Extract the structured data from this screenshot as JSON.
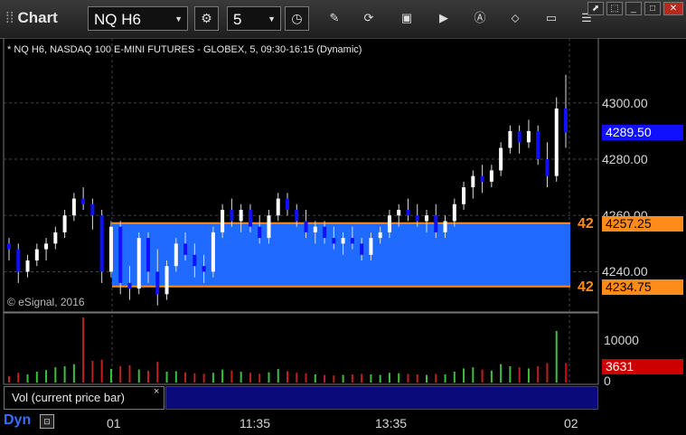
{
  "toolbar": {
    "app_title": "Chart",
    "symbol": "NQ H6",
    "interval": "5"
  },
  "chart": {
    "header_text": "* NQ H6, NASDAQ 100 E-MINI FUTURES - GLOBEX, 5, 09:30-16:15 (Dynamic)",
    "copyright": "© eSignal, 2016",
    "price_ticks": [
      "4300.00",
      "4280.00",
      "4260.00",
      "4240.00"
    ],
    "price_tick_values": [
      4300,
      4280,
      4260,
      4240
    ],
    "last_price": "4289.50",
    "zone_top": {
      "value": 4257.25,
      "label": "4257.25",
      "flag": "42"
    },
    "zone_bottom": {
      "value": 4234.75,
      "label": "4234.75",
      "flag": "42"
    },
    "colors": {
      "up": "#ffffff",
      "down": "#1010ff",
      "zone": "#1f6bff",
      "zone_line": "#ff8c1a",
      "last_price": "#1010ff",
      "volume_last": "#cc0000"
    }
  },
  "volume": {
    "panel_label": "Vol (current price bar)",
    "close_symbol": "×",
    "axis_ticks": [
      "10000",
      "0"
    ],
    "last_volume": "3631"
  },
  "time_axis": [
    "01",
    "11:35",
    "13:35",
    "02"
  ],
  "status": {
    "mode": "Dyn"
  },
  "chart_data": {
    "type": "candlestick",
    "y_range": [
      4226,
      4316
    ],
    "vol_range": [
      0,
      12500
    ],
    "candles": [
      [
        4250,
        4252,
        4244,
        4248,
        1200
      ],
      [
        4248,
        4250,
        4236,
        4240,
        1800
      ],
      [
        4240,
        4246,
        4238,
        4244,
        1500
      ],
      [
        4244,
        4250,
        4242,
        4248,
        2000
      ],
      [
        4248,
        4252,
        4244,
        4250,
        2300
      ],
      [
        4250,
        4256,
        4248,
        4254,
        2800
      ],
      [
        4254,
        4262,
        4252,
        4260,
        3000
      ],
      [
        4260,
        4268,
        4258,
        4266,
        3400
      ],
      [
        4266,
        4270,
        4262,
        4264,
        12000
      ],
      [
        4264,
        4266,
        4255,
        4260,
        4000
      ],
      [
        4260,
        4262,
        4236,
        4240,
        4200
      ],
      [
        4240,
        4258,
        4238,
        4256,
        2500
      ],
      [
        4256,
        4258,
        4232,
        4236,
        3000
      ],
      [
        4236,
        4242,
        4230,
        4234,
        3200
      ],
      [
        4234,
        4254,
        4232,
        4252,
        2400
      ],
      [
        4252,
        4254,
        4236,
        4240,
        2200
      ],
      [
        4240,
        4248,
        4228,
        4232,
        3800
      ],
      [
        4232,
        4244,
        4230,
        4242,
        2000
      ],
      [
        4242,
        4252,
        4240,
        4250,
        2100
      ],
      [
        4250,
        4254,
        4244,
        4246,
        1900
      ],
      [
        4246,
        4250,
        4238,
        4242,
        1700
      ],
      [
        4242,
        4246,
        4236,
        4240,
        1600
      ],
      [
        4240,
        4256,
        4238,
        4254,
        1800
      ],
      [
        4254,
        4264,
        4252,
        4262,
        2400
      ],
      [
        4262,
        4266,
        4256,
        4258,
        2200
      ],
      [
        4258,
        4264,
        4254,
        4262,
        2000
      ],
      [
        4262,
        4264,
        4254,
        4256,
        1800
      ],
      [
        4256,
        4260,
        4250,
        4252,
        1600
      ],
      [
        4252,
        4262,
        4250,
        4260,
        1900
      ],
      [
        4260,
        4268,
        4258,
        4266,
        2500
      ],
      [
        4266,
        4268,
        4260,
        4262,
        2100
      ],
      [
        4262,
        4264,
        4256,
        4258,
        1800
      ],
      [
        4258,
        4262,
        4252,
        4254,
        1700
      ],
      [
        4254,
        4258,
        4250,
        4256,
        1500
      ],
      [
        4256,
        4258,
        4250,
        4252,
        1400
      ],
      [
        4252,
        4256,
        4248,
        4250,
        1300
      ],
      [
        4250,
        4254,
        4246,
        4252,
        1400
      ],
      [
        4252,
        4256,
        4248,
        4250,
        1500
      ],
      [
        4250,
        4252,
        4244,
        4246,
        1600
      ],
      [
        4246,
        4254,
        4244,
        4252,
        1500
      ],
      [
        4252,
        4256,
        4250,
        4254,
        1400
      ],
      [
        4254,
        4262,
        4252,
        4260,
        1800
      ],
      [
        4260,
        4264,
        4256,
        4262,
        1700
      ],
      [
        4262,
        4266,
        4258,
        4260,
        1600
      ],
      [
        4260,
        4264,
        4256,
        4258,
        1500
      ],
      [
        4258,
        4262,
        4254,
        4260,
        1400
      ],
      [
        4260,
        4264,
        4252,
        4254,
        1600
      ],
      [
        4254,
        4260,
        4252,
        4258,
        1500
      ],
      [
        4258,
        4266,
        4256,
        4264,
        2000
      ],
      [
        4264,
        4272,
        4262,
        4270,
        2600
      ],
      [
        4270,
        4276,
        4266,
        4274,
        2800
      ],
      [
        4274,
        4278,
        4268,
        4272,
        2400
      ],
      [
        4272,
        4278,
        4270,
        4276,
        2200
      ],
      [
        4276,
        4286,
        4274,
        4284,
        3400
      ],
      [
        4284,
        4292,
        4282,
        4290,
        3000
      ],
      [
        4290,
        4292,
        4282,
        4286,
        2800
      ],
      [
        4286,
        4294,
        4284,
        4290,
        2600
      ],
      [
        4290,
        4292,
        4278,
        4280,
        3000
      ],
      [
        4280,
        4286,
        4270,
        4274,
        3600
      ],
      [
        4274,
        4302,
        4272,
        4298,
        9500
      ],
      [
        4298,
        4310,
        4284,
        4289.5,
        3631
      ]
    ]
  }
}
